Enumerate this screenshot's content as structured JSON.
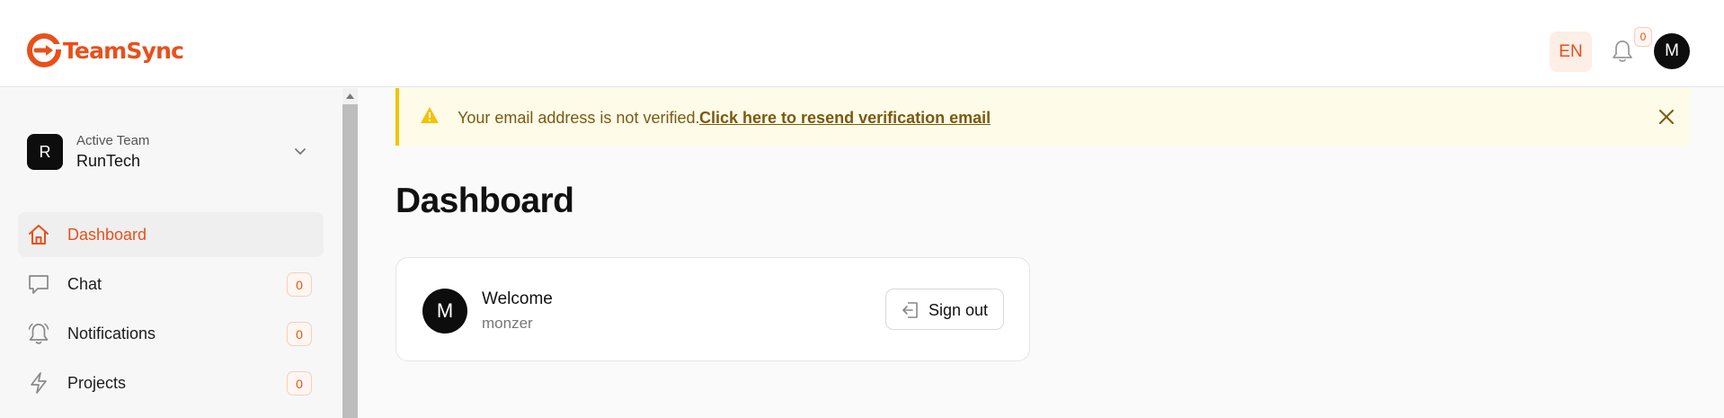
{
  "header": {
    "brand": "TeamSync",
    "language": "EN",
    "notification_count": "0",
    "user_initial": "M",
    "accent": "#e8501a"
  },
  "sidebar": {
    "team": {
      "initial": "R",
      "caption": "Active Team",
      "name": "RunTech"
    },
    "items": [
      {
        "label": "Dashboard",
        "icon": "home-icon",
        "active": true
      },
      {
        "label": "Chat",
        "icon": "chat-icon",
        "count": "0"
      },
      {
        "label": "Notifications",
        "icon": "bell-icon",
        "count": "0"
      },
      {
        "label": "Projects",
        "icon": "lightning-icon",
        "count": "0"
      }
    ]
  },
  "alert": {
    "message": "Your email address is not verified.",
    "link": "Click here to resend verification email",
    "color": "#f2c300"
  },
  "main": {
    "title": "Dashboard",
    "card": {
      "initial": "M",
      "title": "Welcome",
      "username": "monzer",
      "signout_label": "Sign out"
    }
  }
}
